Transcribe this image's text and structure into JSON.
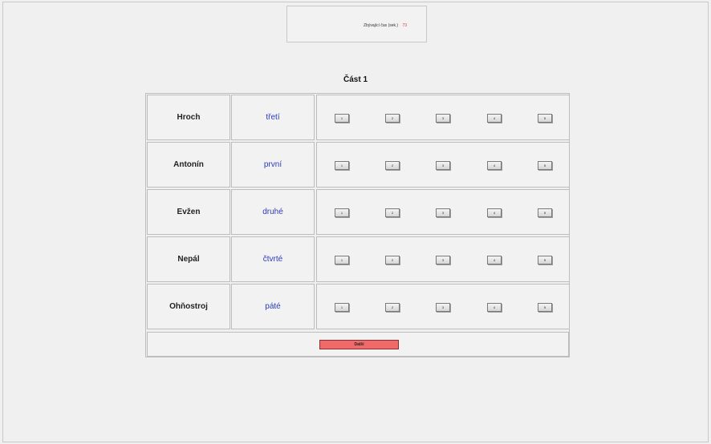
{
  "timer": {
    "label": "Zbývající čas (sek.)",
    "value": "73"
  },
  "section": {
    "title": "Část 1"
  },
  "rows": [
    {
      "word": "Hroch",
      "ordinal": "třetí"
    },
    {
      "word": "Antonín",
      "ordinal": "první"
    },
    {
      "word": "Evžen",
      "ordinal": "druhé"
    },
    {
      "word": "Nepál",
      "ordinal": "čtvrté"
    },
    {
      "word": "Ohňostroj",
      "ordinal": "páté"
    }
  ],
  "rating_labels": [
    "1",
    "2",
    "3",
    "4",
    "5"
  ],
  "next_button": {
    "label": "Další"
  },
  "colors": {
    "ordinal_text": "#2a3bb8",
    "timer_value": "#d23a3a",
    "next_button": "#f06a6a"
  }
}
